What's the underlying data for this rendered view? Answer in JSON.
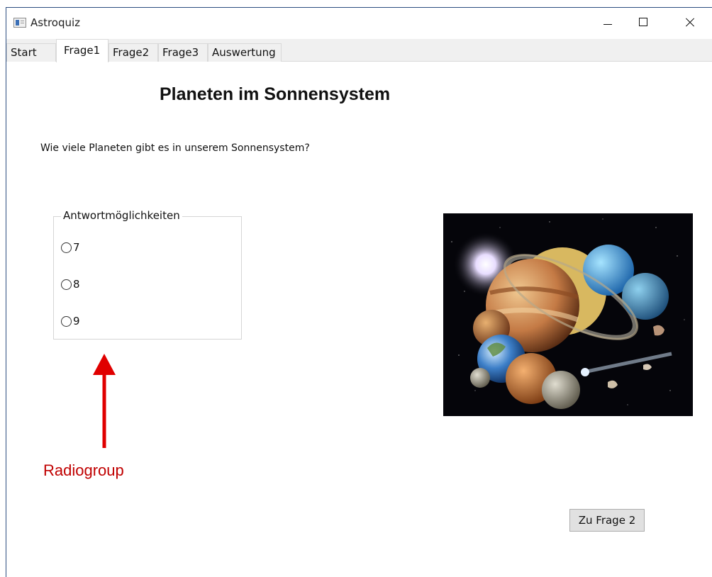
{
  "window": {
    "title": "Astroquiz",
    "icon": "app-window-icon"
  },
  "window_controls": [
    "minimize-icon",
    "maximize-icon",
    "close-icon"
  ],
  "tabs": [
    {
      "label": "Start"
    },
    {
      "label": "Frage1",
      "active": true
    },
    {
      "label": "Frage2"
    },
    {
      "label": "Frage3"
    },
    {
      "label": "Auswertung"
    }
  ],
  "main": {
    "heading": "Planeten im Sonnensystem",
    "question": "Wie viele Planeten gibt es in unserem Sonnensystem?",
    "answer_group": {
      "title": "Antwortmöglichkeiten",
      "options": [
        {
          "label": "7",
          "selected": false
        },
        {
          "label": "8",
          "selected": false
        },
        {
          "label": "9",
          "selected": false
        }
      ]
    },
    "annotation": {
      "label": "Radiogroup",
      "color": "#c00000"
    },
    "next_button": "Zu Frage 2"
  }
}
